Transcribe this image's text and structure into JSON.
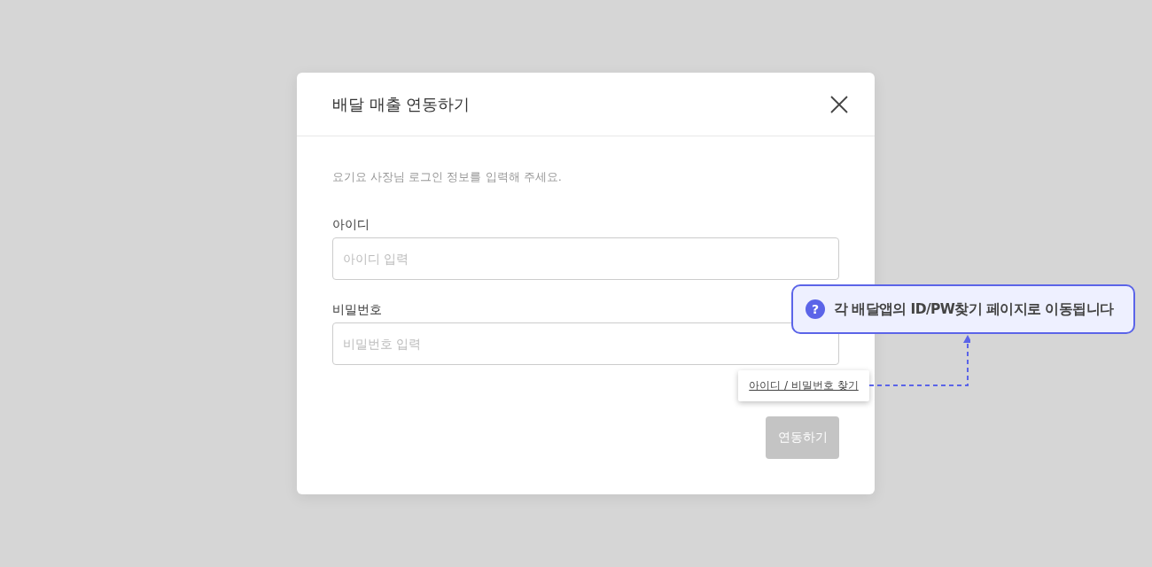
{
  "dialog": {
    "title": "배달 매출 연동하기",
    "description": "요기요 사장님 로그인 정보를 입력해 주세요.",
    "fields": [
      {
        "label": "아이디",
        "placeholder": "아이디 입력"
      },
      {
        "label": "비밀번호",
        "placeholder": "비밀번호 입력"
      }
    ],
    "find_link": "아이디 / 비밀번호 찾기",
    "submit": {
      "label": "연동하기",
      "disabled": true
    }
  },
  "callout": {
    "icon": "?",
    "text": "각 배달앱의 ID/PW찾기 페이지로 이동됩니다"
  }
}
